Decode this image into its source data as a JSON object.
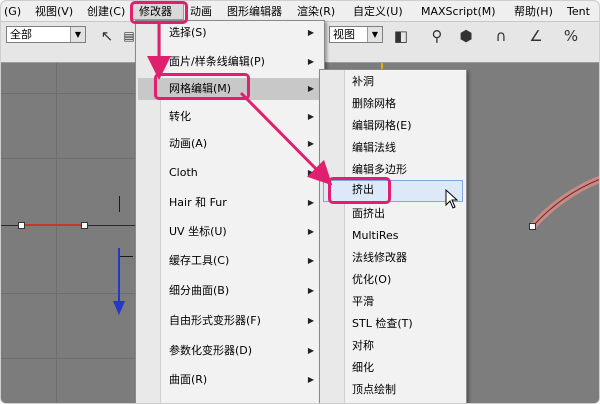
{
  "menubar": {
    "items": [
      "(G)",
      "视图(V)",
      "创建(C)",
      "修改器",
      "动画",
      "图形编辑器",
      "渲染(R)",
      "自定义(U)",
      "MAXScript(M)",
      "帮助(H)",
      "Tent"
    ]
  },
  "toolbar": {
    "selection_filter": "全部",
    "view_select": "视图"
  },
  "modifier_menu": {
    "items": [
      {
        "label": "选择(S)"
      },
      {
        "label": "面片/样条线编辑(P)"
      },
      {
        "label": "网格编辑(M)"
      },
      {
        "label": "转化"
      },
      {
        "label": "动画(A)"
      },
      {
        "label": "Cloth"
      },
      {
        "label": "Hair 和 Fur"
      },
      {
        "label": "UV 坐标(U)"
      },
      {
        "label": "缓存工具(C)"
      },
      {
        "label": "细分曲面(B)"
      },
      {
        "label": "自由形式变形器(F)"
      },
      {
        "label": "参数化变形器(D)"
      },
      {
        "label": "曲面(R)"
      }
    ]
  },
  "mesh_submenu": {
    "items": [
      "补洞",
      "删除网格",
      "编辑网格(E)",
      "编辑法线",
      "编辑多边形",
      "挤出",
      "面挤出",
      "MultiRes",
      "法线修改器",
      "优化(O)",
      "平滑",
      "STL 检查(T)",
      "对称",
      "细化",
      "顶点绘制"
    ]
  },
  "colors": {
    "annotation": "#e0206e",
    "menu_bg": "#f2f2f2",
    "highlight_item": "#dde9f8"
  }
}
